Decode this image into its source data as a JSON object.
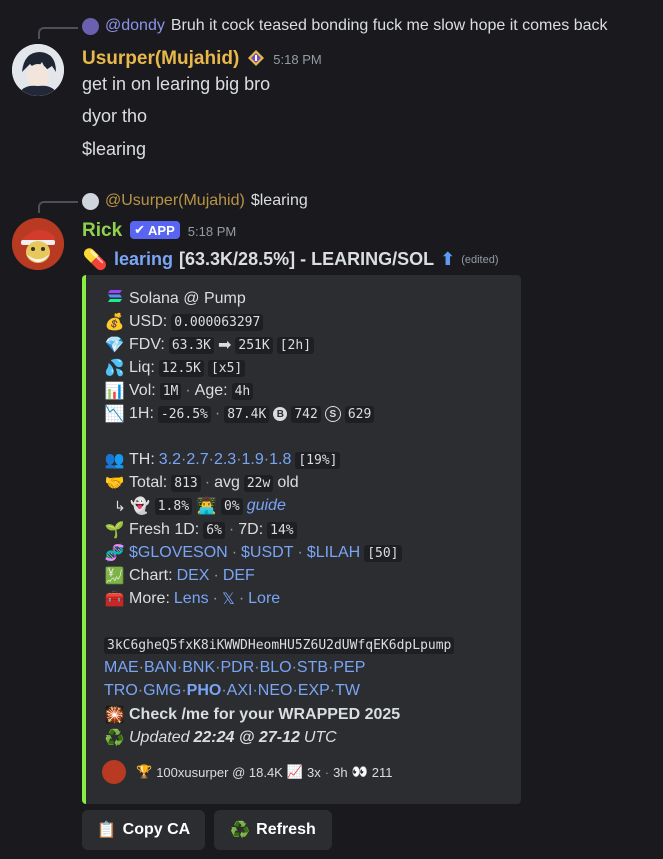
{
  "msg1": {
    "reply_user": "@dondy",
    "reply_text": "Bruh it cock teased bonding fuck me slow hope it comes back",
    "username": "Usurper(Mujahid)",
    "timestamp": "5:18 PM",
    "lines": [
      "get in on learing big bro",
      "dyor tho",
      "$learing"
    ]
  },
  "msg2": {
    "reply_user": "@Usurper(Mujahid)",
    "reply_text": "$learing",
    "username": "Rick",
    "badge": "APP",
    "timestamp": "5:18 PM",
    "title_link": "learing",
    "title_rest": "[63.3K/28.5%] - LEARING/SOL",
    "title_arrow": "⬆",
    "edited": "(edited)"
  },
  "embed": {
    "chain": "Solana @ Pump",
    "usd_label": "USD:",
    "usd_value": "0.000063297",
    "fdv_label": "FDV:",
    "fdv_from": "63.3K",
    "fdv_arrow": "➡",
    "fdv_to": "251K",
    "fdv_period": "[2h]",
    "liq_label": "Liq:",
    "liq_value": "12.5K",
    "liq_mult": "[x5]",
    "vol_label": "Vol:",
    "vol_value": "1M",
    "age_label": "Age:",
    "age_value": "4h",
    "h1_label": "1H:",
    "h1_change": "-26.5%",
    "h1_vol": "87.4K",
    "h1_buys": "742",
    "h1_sells": "629",
    "th_label": "TH:",
    "th_values": [
      "3.2",
      "2.7",
      "2.3",
      "1.9",
      "1.8"
    ],
    "th_total": "[19%]",
    "total_label": "Total:",
    "total_value": "813",
    "avg_label": "avg",
    "avg_value": "22w",
    "old_label": "old",
    "ghost_pct": "1.8%",
    "dev_pct": "0%",
    "guide": "guide",
    "fresh_label": "Fresh 1D:",
    "fresh_1d": "6%",
    "fresh_7d_label": "7D:",
    "fresh_7d": "14%",
    "pairs": [
      "$GLOVESON",
      "$USDT",
      "$LILAH"
    ],
    "pairs_count": "[50]",
    "chart_label": "Chart:",
    "chart_links": [
      "DEX",
      "DEF"
    ],
    "more_label": "More:",
    "more_links": [
      "Lens",
      "𝕏",
      "Lore"
    ],
    "contract": "3kC6gheQ5fxK8iKWWDHeomHU5Z6U2dUWfqEK6dpLpump",
    "bots_row1": [
      "MAE",
      "BAN",
      "BNK",
      "PDR",
      "BLO",
      "STB",
      "PEP"
    ],
    "bots_row2": [
      "TRO",
      "GMG",
      "PHO",
      "AXI",
      "NEO",
      "EXP",
      "TW"
    ],
    "wrapped": "Check /me for your WRAPPED 2025",
    "updated_prefix": "Updated",
    "updated_time": "22:24 @ 27-12",
    "updated_suffix": "UTC",
    "footer_user": "100xusurper @ 18.4K",
    "footer_mult": "3x",
    "footer_time": "3h",
    "footer_views": "211"
  },
  "buttons": {
    "copy": "Copy CA",
    "refresh": "Refresh"
  },
  "colors": {
    "background": "#1a1a1e",
    "embed_bg": "#2b2d31",
    "embed_accent": "#88ee44",
    "usurper_name": "#e8b84a",
    "rick_name": "#8fd14f",
    "link": "#7aa5f5",
    "badge": "#5865f2"
  }
}
